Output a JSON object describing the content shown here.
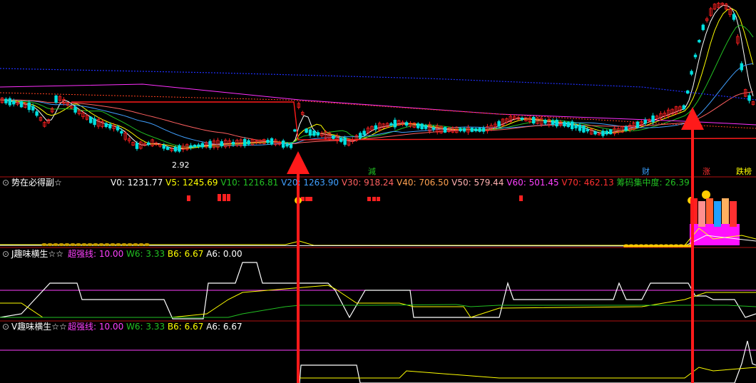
{
  "main_panel": {
    "low_label": "2.92",
    "event_tags": [
      {
        "text": "減",
        "color": "#22c022"
      },
      {
        "text": "财",
        "color": "#3aa0ff"
      },
      {
        "text": "涨",
        "color": "#ff3030"
      },
      {
        "text": "跌榜",
        "color": "#ffff00"
      }
    ]
  },
  "panel_volume": {
    "title": "势在必得副☆",
    "readouts": [
      {
        "label": "V0:",
        "value": "1231.77",
        "color": "#ffffff"
      },
      {
        "label": "V5:",
        "value": "1245.69",
        "color": "#ffff00"
      },
      {
        "label": "V10:",
        "value": "1216.81",
        "color": "#22c022"
      },
      {
        "label": "V20:",
        "value": "1263.90",
        "color": "#40a0ff"
      },
      {
        "label": "V30:",
        "value": "918.24",
        "color": "#ff6060"
      },
      {
        "label": "V40:",
        "value": "706.50",
        "color": "#ffa050"
      },
      {
        "label": "V50:",
        "value": "579.44",
        "color": "#ffb0b0"
      },
      {
        "label": "V60:",
        "value": "501.45",
        "color": "#ff40ff"
      },
      {
        "label": "V70:",
        "value": "462.13",
        "color": "#ff3030"
      },
      {
        "label": "筹码集中度:",
        "value": "26.39",
        "color": "#22c022"
      }
    ]
  },
  "panel_j": {
    "title": "J趣味横生☆☆",
    "readouts": [
      {
        "label": "超强线:",
        "value": "10.00",
        "color": "#ff40ff"
      },
      {
        "label": "W6:",
        "value": "3.33",
        "color": "#22c022"
      },
      {
        "label": "B6:",
        "value": "6.67",
        "color": "#ffff00"
      },
      {
        "label": "A6:",
        "value": "0.00",
        "color": "#ffffff"
      }
    ]
  },
  "panel_v": {
    "title": "V趣味横生☆☆",
    "readouts": [
      {
        "label": "超强线:",
        "value": "10.00",
        "color": "#ff40ff"
      },
      {
        "label": "W6:",
        "value": "3.33",
        "color": "#22c022"
      },
      {
        "label": "B6:",
        "value": "6.67",
        "color": "#ffff00"
      },
      {
        "label": "A6:",
        "value": "6.67",
        "color": "#ffffff"
      }
    ]
  },
  "colors": {
    "background": "#000000",
    "separator": "#b01010",
    "signal_arrow": "#ff1a1a",
    "up_candle": "#ff2020",
    "down_candle": "#00e0e0"
  },
  "chart_data": {
    "type": "candlestick",
    "title": "",
    "xlabel": "",
    "ylabel": "",
    "annotated_low": 2.92,
    "signal_arrows": 2,
    "panels": [
      "main",
      "势在必得副☆",
      "J趣味横生☆☆",
      "V趣味横生☆☆"
    ]
  }
}
